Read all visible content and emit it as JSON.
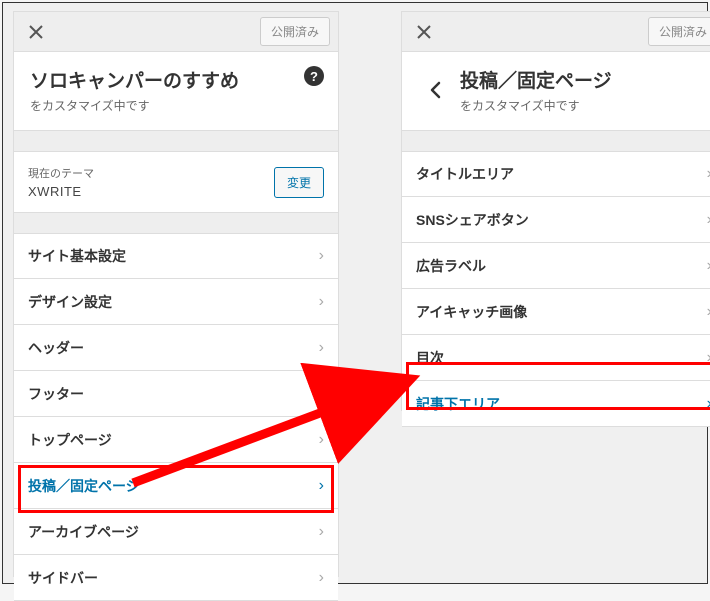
{
  "left": {
    "published_label": "公開済み",
    "title": "ソロキャンパーのすすめ",
    "subtitle": "をカスタマイズ中です",
    "theme_label": "現在のテーマ",
    "theme_name": "XWRITE",
    "change_label": "変更",
    "menu": [
      "サイト基本設定",
      "デザイン設定",
      "ヘッダー",
      "フッター",
      "トップページ",
      "投稿／固定ページ",
      "アーカイブページ",
      "サイドバー"
    ]
  },
  "right": {
    "published_label": "公開済み",
    "title": "投稿／固定ページ",
    "subtitle": "をカスタマイズ中です",
    "menu": [
      "タイトルエリア",
      "SNSシェアボタン",
      "広告ラベル",
      "アイキャッチ画像",
      "目次",
      "記事下エリア"
    ]
  }
}
